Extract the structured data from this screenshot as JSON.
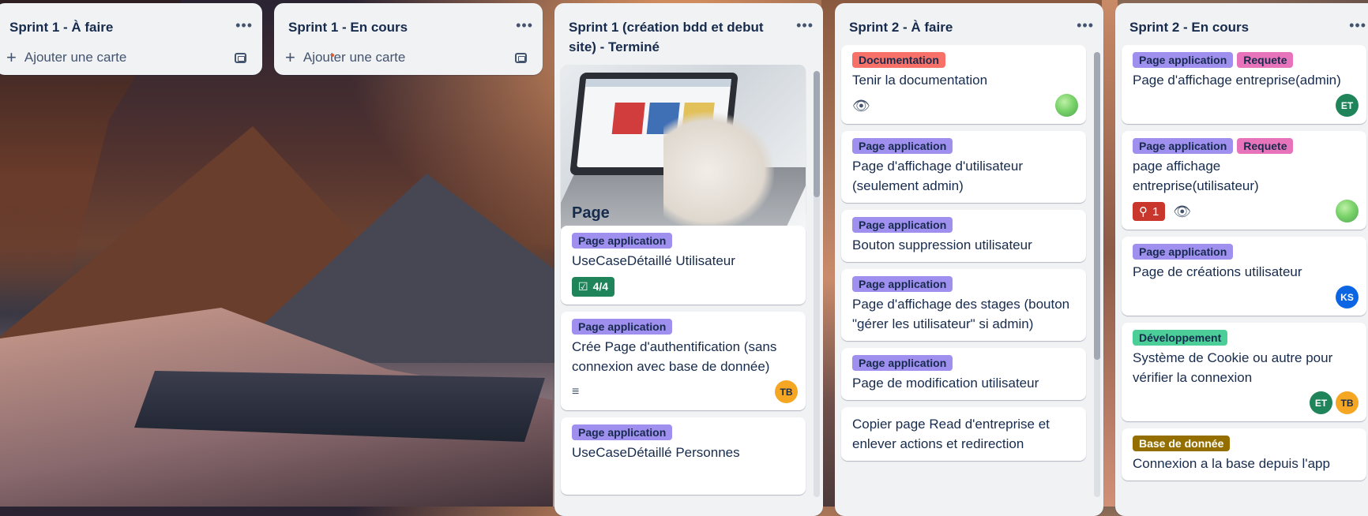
{
  "lists": [
    {
      "title": "Sprint 1 - À faire",
      "add_label": "Ajouter une carte"
    },
    {
      "title": "Sprint 1 - En cours",
      "add_label": "Ajouter une carte"
    },
    {
      "title": "Sprint 1 (création bdd et debut site) - Terminé",
      "cards": [
        {
          "cover_title": "Page"
        },
        {
          "labels": [
            "Page application"
          ],
          "title": "UseCaseDétaillé Utilisateur",
          "checklist": "4/4"
        },
        {
          "labels": [
            "Page application"
          ],
          "title": "Crée Page d'authentification (sans connexion avec base de donnée)",
          "avatars": [
            "TB"
          ]
        },
        {
          "labels": [
            "Page application"
          ],
          "title": "UseCaseDétaillé Personnes"
        }
      ]
    },
    {
      "title": "Sprint 2 - À faire",
      "cards": [
        {
          "labels": [
            "Documentation"
          ],
          "title": "Tenir la documentation"
        },
        {
          "labels": [
            "Page application"
          ],
          "title": "Page d'affichage d'utilisateur (seulement admin)"
        },
        {
          "labels": [
            "Page application"
          ],
          "title": "Bouton suppression utilisateur"
        },
        {
          "labels": [
            "Page application"
          ],
          "title": "Page d'affichage des stages (bouton \"gérer les utilisateur\" si admin)"
        },
        {
          "labels": [
            "Page application"
          ],
          "title": "Page de modification utilisateur"
        },
        {
          "title": "Copier page Read d'entreprise et enlever actions et redirection"
        }
      ]
    },
    {
      "title": "Sprint 2 - En cours",
      "cards": [
        {
          "labels": [
            "Page application",
            "Requete"
          ],
          "title": "Page d'affichage entreprise(admin)",
          "avatars": [
            "ET"
          ]
        },
        {
          "labels": [
            "Page application",
            "Requete"
          ],
          "title": "page affichage entreprise(utilisateur)",
          "comments": "1"
        },
        {
          "labels": [
            "Page application"
          ],
          "title": "Page de créations utilisateur",
          "avatars": [
            "KS"
          ]
        },
        {
          "labels": [
            "Développement"
          ],
          "title": "Système de Cookie ou autre pour vérifier la connexion",
          "avatars": [
            "ET",
            "TB"
          ]
        },
        {
          "labels": [
            "Base de donnée"
          ],
          "title": "Connexion a la base depuis l'app"
        }
      ]
    }
  ],
  "icons": {
    "more": "•••",
    "plus": "+",
    "eye": "👁",
    "description": "≡",
    "checklist": "☑",
    "pin": "⚲"
  },
  "colors": {
    "label_purple": "#9f8fef",
    "label_red": "#f87168",
    "label_pink": "#e774bb",
    "label_green": "#4bce97",
    "label_brown": "#946f00",
    "list_bg": "#f1f2f4"
  }
}
